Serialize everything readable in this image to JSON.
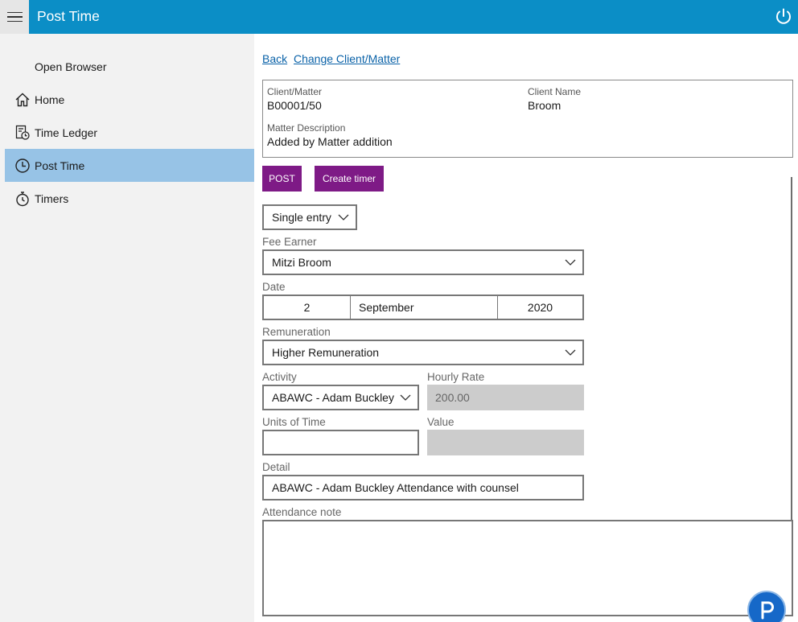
{
  "titlebar": {
    "title": "Post Time"
  },
  "sidebar": {
    "items": [
      {
        "label": "Open Browser"
      },
      {
        "label": "Home"
      },
      {
        "label": "Time Ledger"
      },
      {
        "label": "Post Time"
      },
      {
        "label": "Timers"
      }
    ]
  },
  "links": {
    "back": "Back",
    "change": "Change Client/Matter"
  },
  "info": {
    "client_matter_label": "Client/Matter",
    "client_matter_value": "B00001/50",
    "client_name_label": "Client Name",
    "client_name_value": "Broom",
    "matter_desc_label": "Matter Description",
    "matter_desc_value": "Added by Matter addition"
  },
  "buttons": {
    "post": "POST",
    "create_timer": "Create timer"
  },
  "form": {
    "entry_type": "Single entry",
    "fee_earner_label": "Fee Earner",
    "fee_earner_value": "Mitzi Broom",
    "date_label": "Date",
    "date_day": "2",
    "date_month": "September",
    "date_year": "2020",
    "remuneration_label": "Remuneration",
    "remuneration_value": "Higher Remuneration",
    "activity_label": "Activity",
    "activity_value": "ABAWC - Adam Buckley",
    "hourly_rate_label": "Hourly Rate",
    "hourly_rate_value": "200.00",
    "units_label": "Units of Time",
    "units_value": "",
    "value_label": "Value",
    "value_value": "",
    "detail_label": "Detail",
    "detail_value": "ABAWC - Adam Buckley Attendance with counsel",
    "attendance_label": "Attendance note"
  },
  "icons": {
    "menu": "hamburger-icon",
    "power": "power-icon",
    "home": "home-icon",
    "ledger": "ledger-icon",
    "clock": "clock-icon",
    "timer": "stopwatch-icon",
    "fab": "p-logo-icon"
  },
  "colors": {
    "titlebar": "#0b8ec6",
    "active_nav": "#97c3e6",
    "button": "#7e1a86",
    "link": "#0a62a8"
  }
}
